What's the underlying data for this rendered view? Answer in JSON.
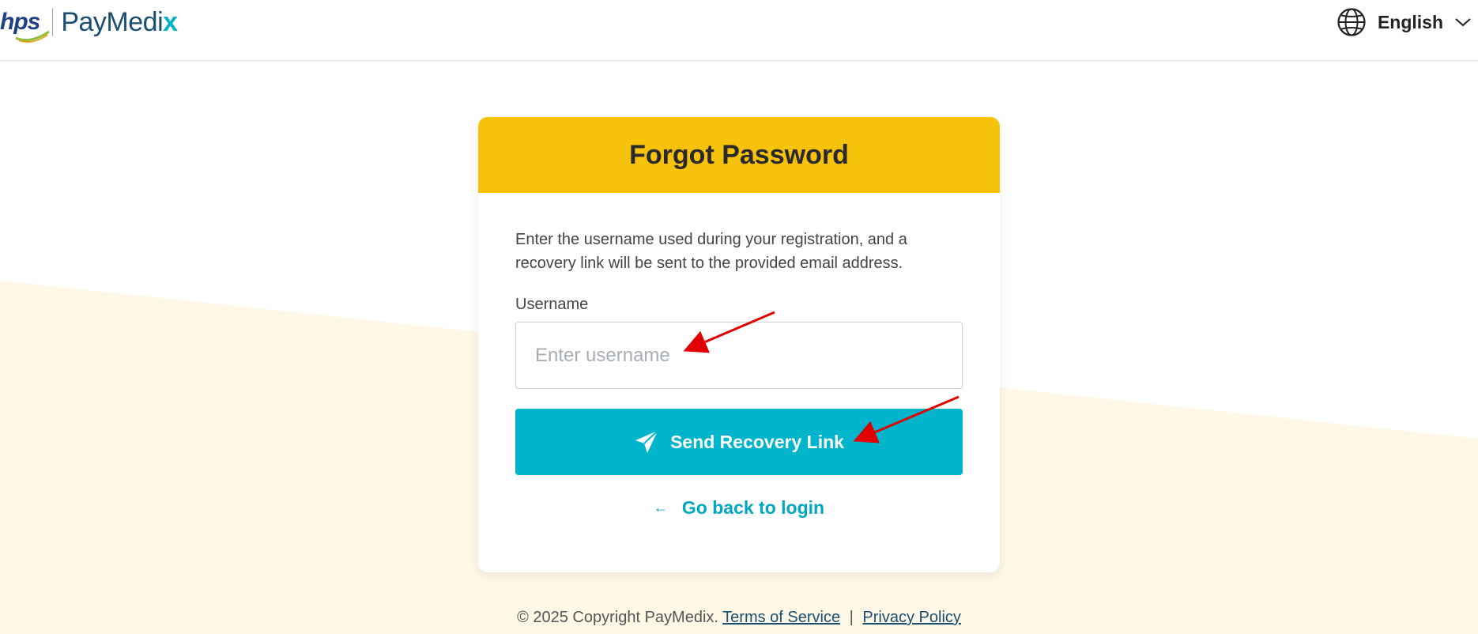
{
  "header": {
    "logo_hps": "hps",
    "logo_brand": "PayMedi",
    "logo_brand_x": "x",
    "language": "English"
  },
  "card": {
    "title": "Forgot Password",
    "description": "Enter the username used during your registration, and a recovery link will be sent to the provided email address.",
    "username_label": "Username",
    "username_placeholder": "Enter username",
    "username_value": "",
    "send_button_label": "Send Recovery Link",
    "back_link_label": "Go back to login",
    "back_arrow": "←"
  },
  "footer": {
    "copyright": "© 2025 Copyright PayMedix.",
    "terms": "Terms of Service",
    "separator": "|",
    "privacy": "Privacy Policy"
  },
  "colors": {
    "header_yellow": "#f7c20c",
    "button_teal": "#00b4cb",
    "link_teal": "#00a7be",
    "brand_navy": "#1a4f72",
    "background_cream": "#fff8e6",
    "annotation_red": "#e00000"
  },
  "icons": {
    "language": "globe-icon",
    "dropdown": "chevron-down-icon",
    "send": "paper-plane-icon",
    "back": "arrow-left-icon"
  }
}
